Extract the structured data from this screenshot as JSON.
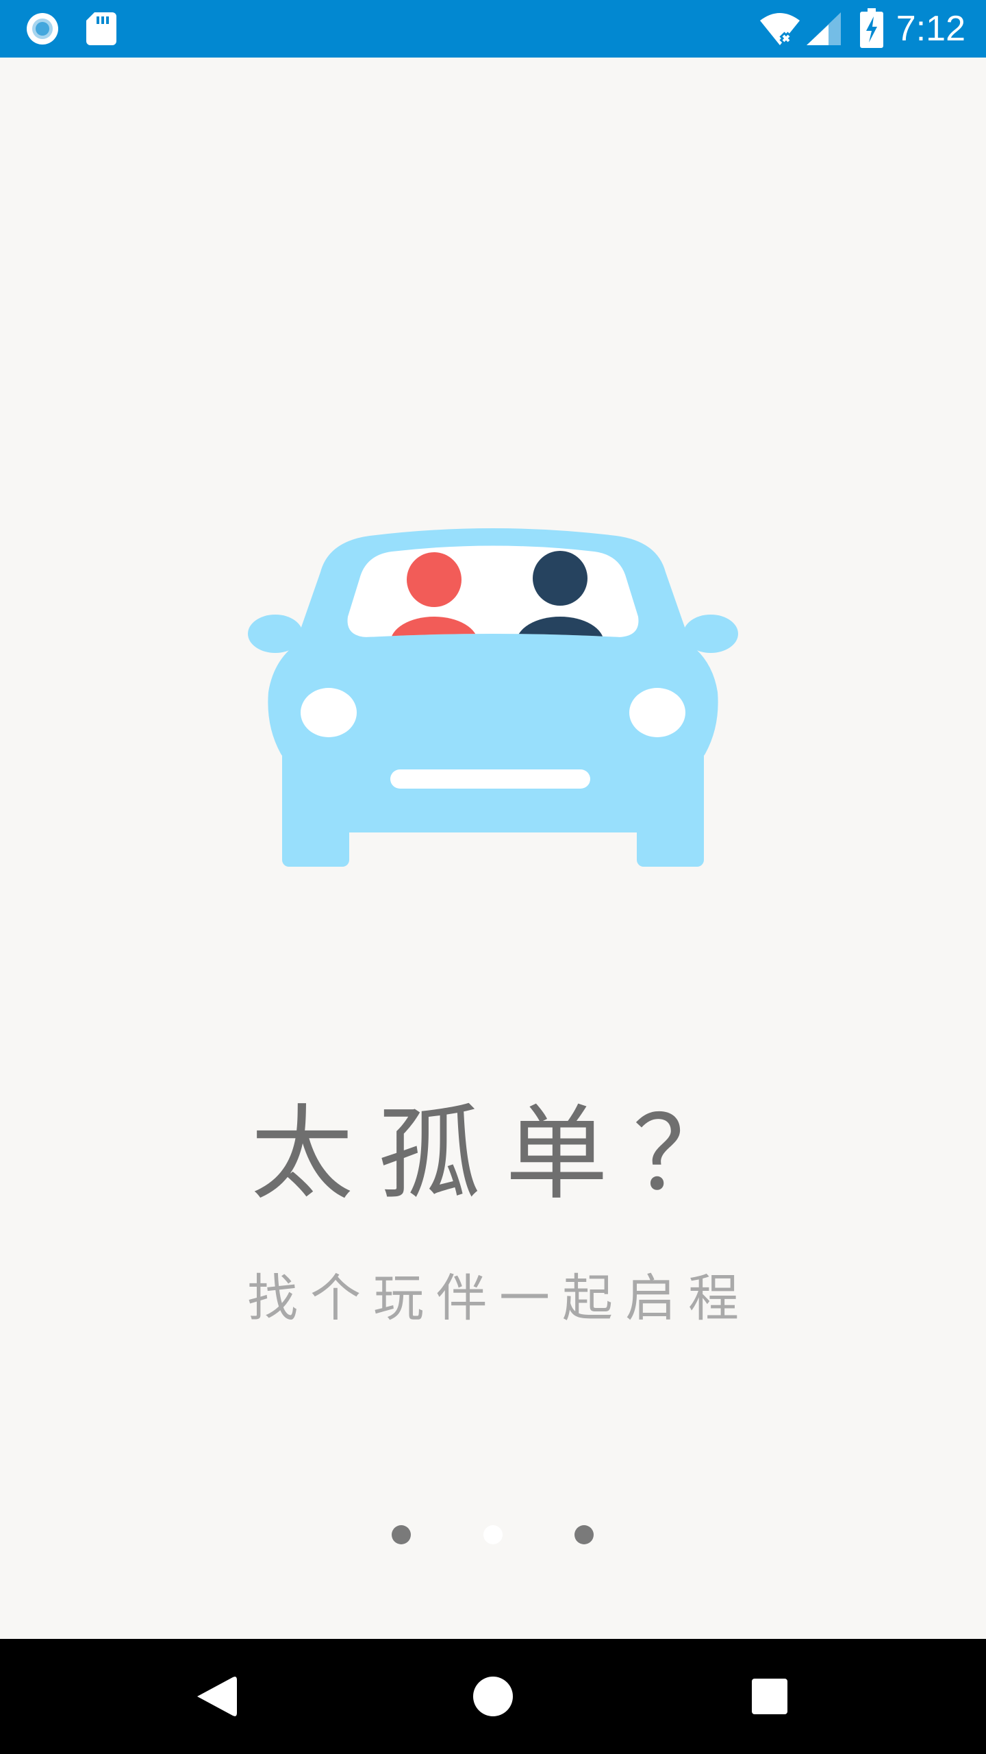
{
  "status_bar": {
    "time": "7:12",
    "background": "#0288d1",
    "icons": [
      "notification-circle-icon",
      "sd-card-icon",
      "wifi-no-internet-icon",
      "cell-signal-icon",
      "battery-charging-icon"
    ]
  },
  "onboarding": {
    "illustration": "car-with-two-passengers",
    "title": "太孤单？",
    "subtitle": "找个玩伴一起启程",
    "pages": 3,
    "current_page": 2,
    "colors": {
      "car": "#98dffc",
      "passenger_left": "#f25c58",
      "passenger_right": "#26435f",
      "title_text": "#6f6f6f",
      "subtitle_text": "#a9a9a9"
    }
  },
  "nav_bar": {
    "buttons": [
      "back-icon",
      "home-icon",
      "recents-icon"
    ]
  }
}
